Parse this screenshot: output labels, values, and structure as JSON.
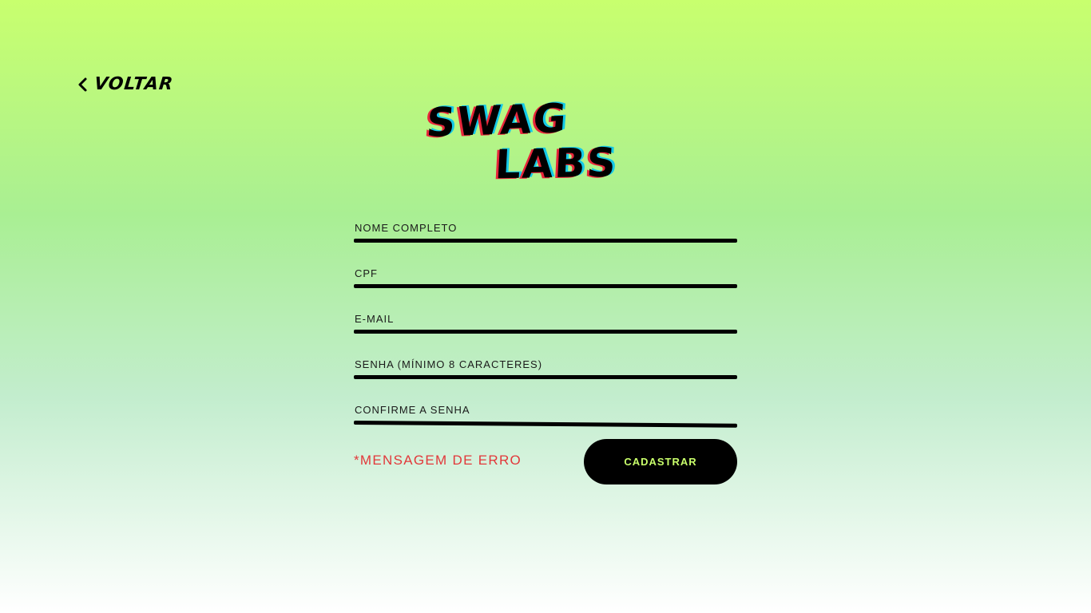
{
  "nav": {
    "back_label": "VOLTAR",
    "back_icon": "chevron-left-icon"
  },
  "logo": {
    "line1": "SWAG",
    "line2": "LABS",
    "colors": {
      "fill": "#000000",
      "shadow_red": "#e8253a",
      "shadow_cyan": "#14c9e8"
    }
  },
  "form": {
    "fields": [
      {
        "placeholder": "NOME COMPLETO",
        "value": ""
      },
      {
        "placeholder": "CPF",
        "value": ""
      },
      {
        "placeholder": "E-MAIL",
        "value": ""
      },
      {
        "placeholder": "SENHA (MÍNIMO 8 CARACTERES)",
        "value": ""
      },
      {
        "placeholder": "CONFIRME A SENHA",
        "value": ""
      }
    ],
    "error_message": "*MENSAGEM DE ERRO",
    "submit_label": "CADASTRAR"
  },
  "colors": {
    "accent": "#c9ff6b",
    "error": "#e2383a",
    "button_bg": "#000000",
    "background_top": "#c8ff6e",
    "background_bottom": "#ffffff"
  }
}
